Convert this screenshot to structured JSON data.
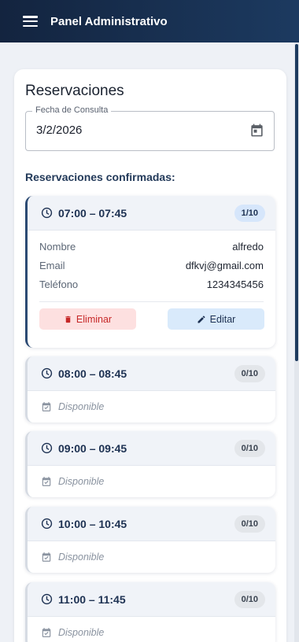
{
  "header": {
    "title": "Panel Administrativo"
  },
  "page": {
    "title": "Reservaciones"
  },
  "date_field": {
    "label": "Fecha de Consulta",
    "value": "3/2/2026"
  },
  "section": {
    "label": "Reservaciones confirmadas:"
  },
  "slots": [
    {
      "time": "07:00 – 07:45",
      "count": "1/10",
      "reservation": {
        "name_label": "Nombre",
        "name": "alfredo",
        "email_label": "Email",
        "email": "dfkvj@gmail.com",
        "phone_label": "Teléfono",
        "phone": "1234345456"
      },
      "delete_label": "Eliminar",
      "edit_label": "Editar"
    },
    {
      "time": "08:00 – 08:45",
      "count": "0/10",
      "status": "Disponible"
    },
    {
      "time": "09:00 – 09:45",
      "count": "0/10",
      "status": "Disponible"
    },
    {
      "time": "10:00 – 10:45",
      "count": "0/10",
      "status": "Disponible"
    },
    {
      "time": "11:00 – 11:45",
      "count": "0/10",
      "status": "Disponible"
    }
  ],
  "colors": {
    "header_bg": "#13243f",
    "accent": "#2b4a73",
    "delete": "#c62828",
    "badge_filled": "#d6e6fb"
  }
}
